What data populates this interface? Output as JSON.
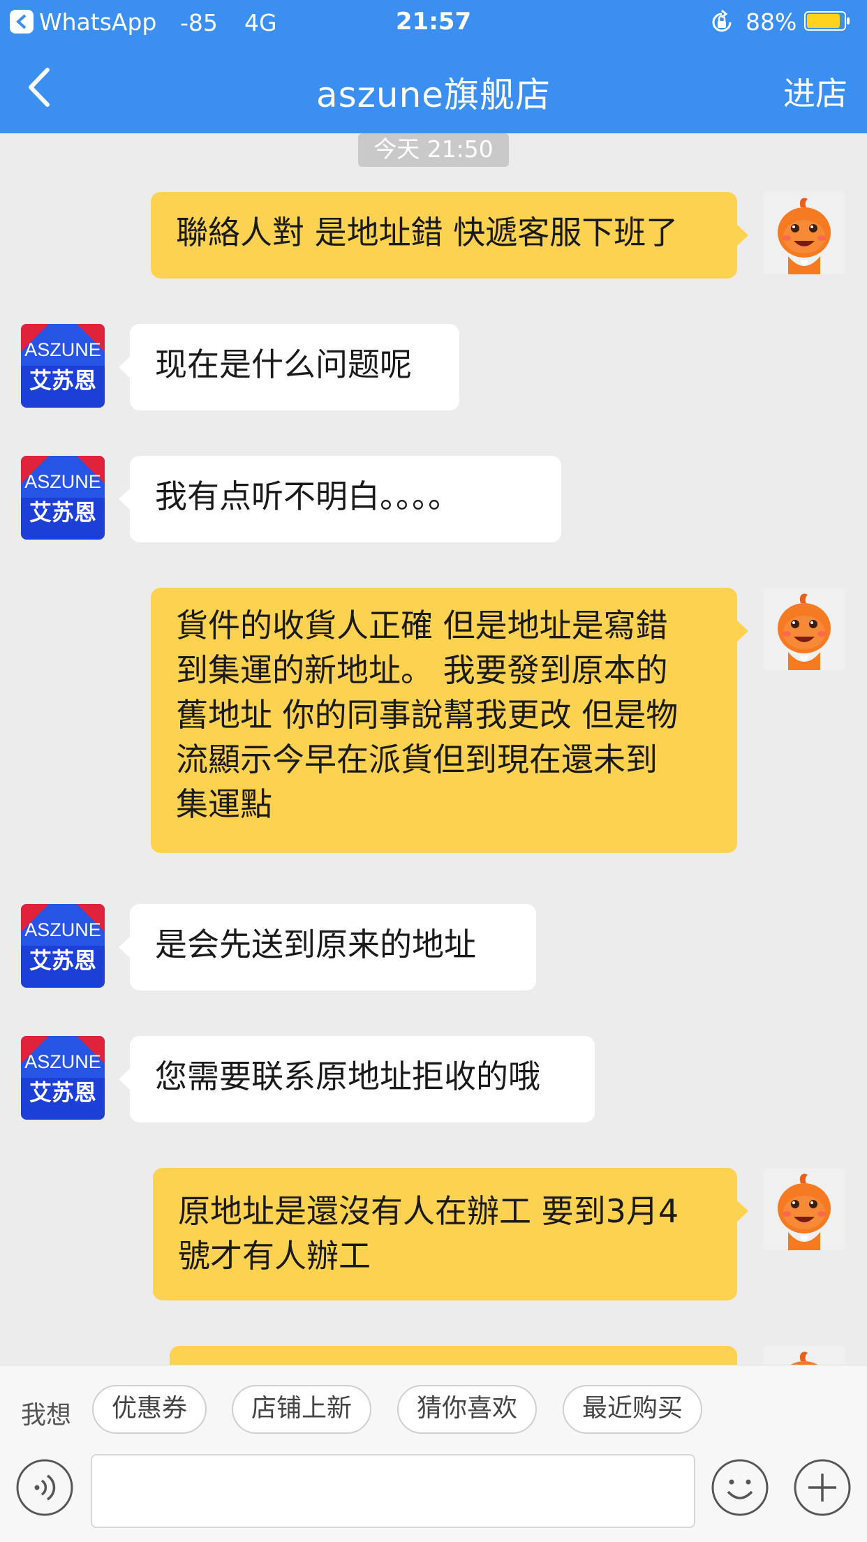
{
  "status_bar": {
    "back_app": "WhatsApp",
    "signal": "-85",
    "network": "4G",
    "time": "21:57",
    "battery_pct": "88%"
  },
  "nav": {
    "title": "aszune旗舰店",
    "enter_label": "进店"
  },
  "chat": {
    "timestamp": "今天 21:50",
    "shop_avatar_lines": [
      "ASZUNE",
      "艾苏恩"
    ],
    "messages": [
      {
        "from": "me",
        "text": "聯絡人對 是地址錯 快遞客服下班了"
      },
      {
        "from": "shop",
        "text": "现在是什么问题呢"
      },
      {
        "from": "shop",
        "text": "我有点听不明白。。。。"
      },
      {
        "from": "me",
        "lines": [
          "貨件的收貨人正確 但是地址是寫錯",
          "到集運的新地址。 我要發到原本的",
          "舊地址 你的同事說幫我更改 但是物",
          "流顯示今早在派貨但到現在還未到",
          "集運點"
        ]
      },
      {
        "from": "shop",
        "text": "是会先送到原来的地址"
      },
      {
        "from": "shop",
        "text": "您需要联系原地址拒收的哦"
      },
      {
        "from": "me",
        "lines": [
          "原地址是還沒有人在辦工 要到3月4",
          "號才有人辦工"
        ]
      }
    ]
  },
  "bottom": {
    "want_label": "我想",
    "quick_replies": [
      "优惠券",
      "店铺上新",
      "猜你喜欢",
      "最近购买"
    ],
    "input_value": ""
  },
  "colors": {
    "nav_bg": "#3a8ff0",
    "bubble_out": "#fdd250",
    "bubble_in": "#ffffff",
    "chat_bg": "#ececec"
  }
}
